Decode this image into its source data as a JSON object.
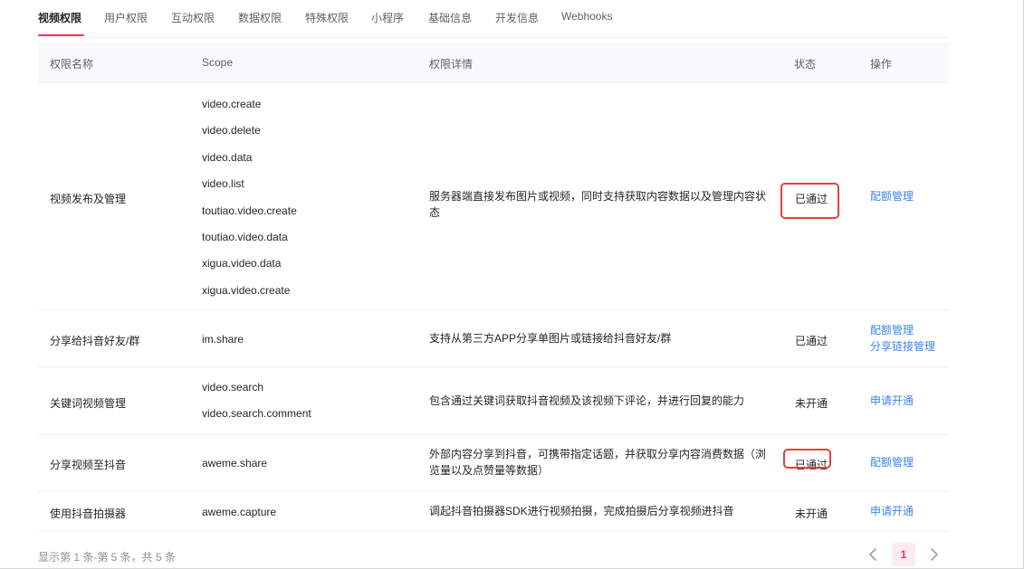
{
  "tabs": [
    {
      "label": "视频权限"
    },
    {
      "label": "用户权限"
    },
    {
      "label": "互动权限"
    },
    {
      "label": "数据权限"
    },
    {
      "label": "特殊权限"
    },
    {
      "label": "小程序"
    },
    {
      "label": "基础信息"
    },
    {
      "label": "开发信息"
    },
    {
      "label": "Webhooks"
    }
  ],
  "table": {
    "headers": {
      "name": "权限名称",
      "scope": "Scope",
      "detail": "权限详情",
      "status": "状态",
      "action": "操作"
    },
    "rows": [
      {
        "name": "视频发布及管理",
        "scopes": [
          "video.create",
          "video.delete",
          "video.data",
          "video.list",
          "toutiao.video.create",
          "toutiao.video.data",
          "xigua.video.data",
          "xigua.video.create"
        ],
        "detail": "服务器端直接发布图片或视频，同时支持获取内容数据以及管理内容状态",
        "status": "已通过",
        "actions": [
          "配额管理"
        ]
      },
      {
        "name": "分享给抖音好友/群",
        "scopes": [
          "im.share"
        ],
        "detail": "支持从第三方APP分享单图片或链接给抖音好友/群",
        "status": "已通过",
        "actions": [
          "配额管理",
          "分享链接管理"
        ]
      },
      {
        "name": "关键词视频管理",
        "scopes": [
          "video.search",
          "video.search.comment"
        ],
        "detail": "包含通过关键词获取抖音视频及该视频下评论，并进行回复的能力",
        "status": "未开通",
        "actions": [
          "申请开通"
        ]
      },
      {
        "name": "分享视频至抖音",
        "scopes": [
          "aweme.share"
        ],
        "detail": "外部内容分享到抖音，可携带指定话题，并获取分享内容消费数据（浏览量以及点赞量等数据）",
        "status": "已通过",
        "actions": [
          "配额管理"
        ]
      },
      {
        "name": "使用抖音拍摄器",
        "scopes": [
          "aweme.capture"
        ],
        "detail": "调起抖音拍摄器SDK进行视频拍摄，完成拍摄后分享视频进抖音",
        "status": "未开通",
        "actions": [
          "申请开通"
        ]
      }
    ]
  },
  "pagination": {
    "summary": "显示第 1 条-第 5 条，共 5 条",
    "current_page": "1",
    "prev_icon": "chevron-left-icon",
    "next_icon": "chevron-right-icon"
  },
  "colors": {
    "accent": "#fe2c55",
    "link": "#3a86e8",
    "highlight": "#e5413a"
  }
}
